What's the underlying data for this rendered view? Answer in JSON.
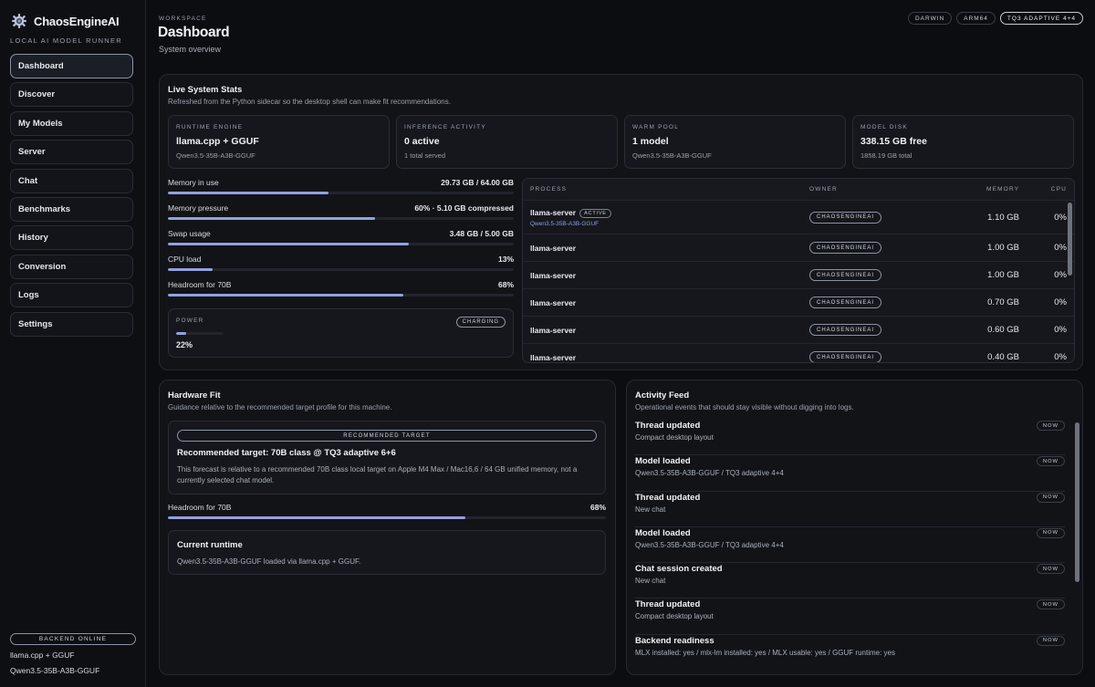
{
  "brand": {
    "name": "ChaosEngineAI",
    "tagline": "LOCAL AI MODEL RUNNER"
  },
  "nav": [
    {
      "label": "Dashboard",
      "active": true
    },
    {
      "label": "Discover"
    },
    {
      "label": "My Models"
    },
    {
      "label": "Server"
    },
    {
      "label": "Chat"
    },
    {
      "label": "Benchmarks"
    },
    {
      "label": "History"
    },
    {
      "label": "Conversion"
    },
    {
      "label": "Logs"
    },
    {
      "label": "Settings"
    }
  ],
  "backend": {
    "status": "BACKEND ONLINE",
    "engine": "llama.cpp + GGUF",
    "model": "Qwen3.5-35B-A3B-GGUF"
  },
  "header": {
    "eyebrow": "WORKSPACE",
    "title": "Dashboard",
    "subtitle": "System overview"
  },
  "chips": [
    "DARWIN",
    "ARM64",
    "TQ3 ADAPTIVE 4+4"
  ],
  "live": {
    "title": "Live System Stats",
    "subtitle": "Refreshed from the Python sidecar so the desktop shell can make fit recommendations.",
    "cards": [
      {
        "label": "RUNTIME ENGINE",
        "value": "llama.cpp + GGUF",
        "sub": "Qwen3.5-35B-A3B-GGUF"
      },
      {
        "label": "INFERENCE ACTIVITY",
        "value": "0 active",
        "sub": "1 total served"
      },
      {
        "label": "WARM POOL",
        "value": "1 model",
        "sub": "Qwen3.5-35B-A3B-GGUF"
      },
      {
        "label": "MODEL DISK",
        "value": "338.15 GB free",
        "sub": "1858.19 GB total"
      }
    ],
    "metrics": [
      {
        "label": "Memory in use",
        "value": "29.73 GB / 64.00 GB",
        "fill": 0.465
      },
      {
        "label": "Memory pressure",
        "value": "60% · 5.10 GB compressed",
        "fill": 0.6
      },
      {
        "label": "Swap usage",
        "value": "3.48 GB / 5.00 GB",
        "fill": 0.696
      },
      {
        "label": "CPU load",
        "value": "13%",
        "fill": 0.13
      },
      {
        "label": "Headroom for 70B",
        "value": "68%",
        "fill": 0.68
      }
    ],
    "power": {
      "label": "POWER",
      "badge": "CHARGING",
      "value": "22%",
      "fill": 0.22
    },
    "process_headers": {
      "process": "PROCESS",
      "owner": "OWNER",
      "memory": "MEMORY",
      "cpu": "CPU"
    },
    "processes": [
      {
        "name": "llama-server",
        "badge": "ACTIVE",
        "model": "Qwen3.5-35B-A3B-GGUF",
        "owner": "CHAOSENGINEAI",
        "memory": "1.10 GB",
        "cpu": "0%"
      },
      {
        "name": "llama-server",
        "owner": "CHAOSENGINEAI",
        "memory": "1.00 GB",
        "cpu": "0%"
      },
      {
        "name": "llama-server",
        "owner": "CHAOSENGINEAI",
        "memory": "1.00 GB",
        "cpu": "0%"
      },
      {
        "name": "llama-server",
        "owner": "CHAOSENGINEAI",
        "memory": "0.70 GB",
        "cpu": "0%"
      },
      {
        "name": "llama-server",
        "owner": "CHAOSENGINEAI",
        "memory": "0.60 GB",
        "cpu": "0%"
      },
      {
        "name": "llama-server",
        "owner": "CHAOSENGINEAI",
        "memory": "0.40 GB",
        "cpu": "0%"
      }
    ]
  },
  "hardware": {
    "title": "Hardware Fit",
    "subtitle": "Guidance relative to the recommended target profile for this machine.",
    "target_badge": "RECOMMENDED TARGET",
    "target_title": "Recommended target: 70B class @ TQ3 adaptive 6+6",
    "target_desc": "This forecast is relative to a recommended 70B class local target on Apple M4 Max / Mac16,6 / 64 GB unified memory, not a currently selected chat model.",
    "headroom": {
      "label": "Headroom for 70B",
      "value": "68%",
      "fill": 0.68
    },
    "runtime_title": "Current runtime",
    "runtime_desc": "Qwen3.5-35B-A3B-GGUF loaded via llama.cpp + GGUF."
  },
  "activity": {
    "title": "Activity Feed",
    "subtitle": "Operational events that should stay visible without digging into logs.",
    "items": [
      {
        "title": "Thread updated",
        "sub": "Compact desktop layout",
        "time": "NOW"
      },
      {
        "title": "Model loaded",
        "sub": "Qwen3.5-35B-A3B-GGUF / TQ3 adaptive 4+4",
        "time": "NOW"
      },
      {
        "title": "Thread updated",
        "sub": "New chat",
        "time": "NOW"
      },
      {
        "title": "Model loaded",
        "sub": "Qwen3.5-35B-A3B-GGUF / TQ3 adaptive 4+4",
        "time": "NOW"
      },
      {
        "title": "Chat session created",
        "sub": "New chat",
        "time": "NOW"
      },
      {
        "title": "Thread updated",
        "sub": "Compact desktop layout",
        "time": "NOW"
      },
      {
        "title": "Backend readiness",
        "sub": "MLX installed: yes / mlx-lm installed: yes / MLX usable: yes / GGUF runtime: yes",
        "time": "NOW"
      }
    ]
  }
}
